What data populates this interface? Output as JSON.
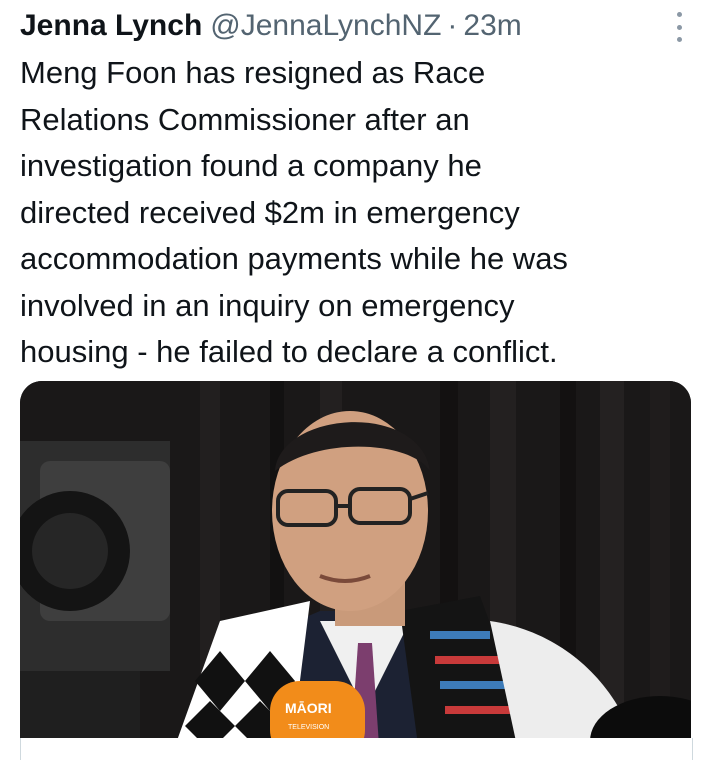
{
  "tweet": {
    "author_name": "Jenna Lynch",
    "handle": "@JennaLynchNZ",
    "separator": "·",
    "timestamp": "23m",
    "text": "Meng Foon has resigned as Race\nRelations Commissioner after an\ninvestigation found a company he\ndirected received $2m in emergency\naccommodation payments while he was\ninvolved in an inquiry on emergency\nhousing - he failed to declare a conflict.",
    "more_icon": "more-vertical-icon"
  },
  "media": {
    "microphone_label": "MĀORI",
    "microphone_sublabel": "TELEVISION",
    "microphone_color": "#f28c1a"
  }
}
